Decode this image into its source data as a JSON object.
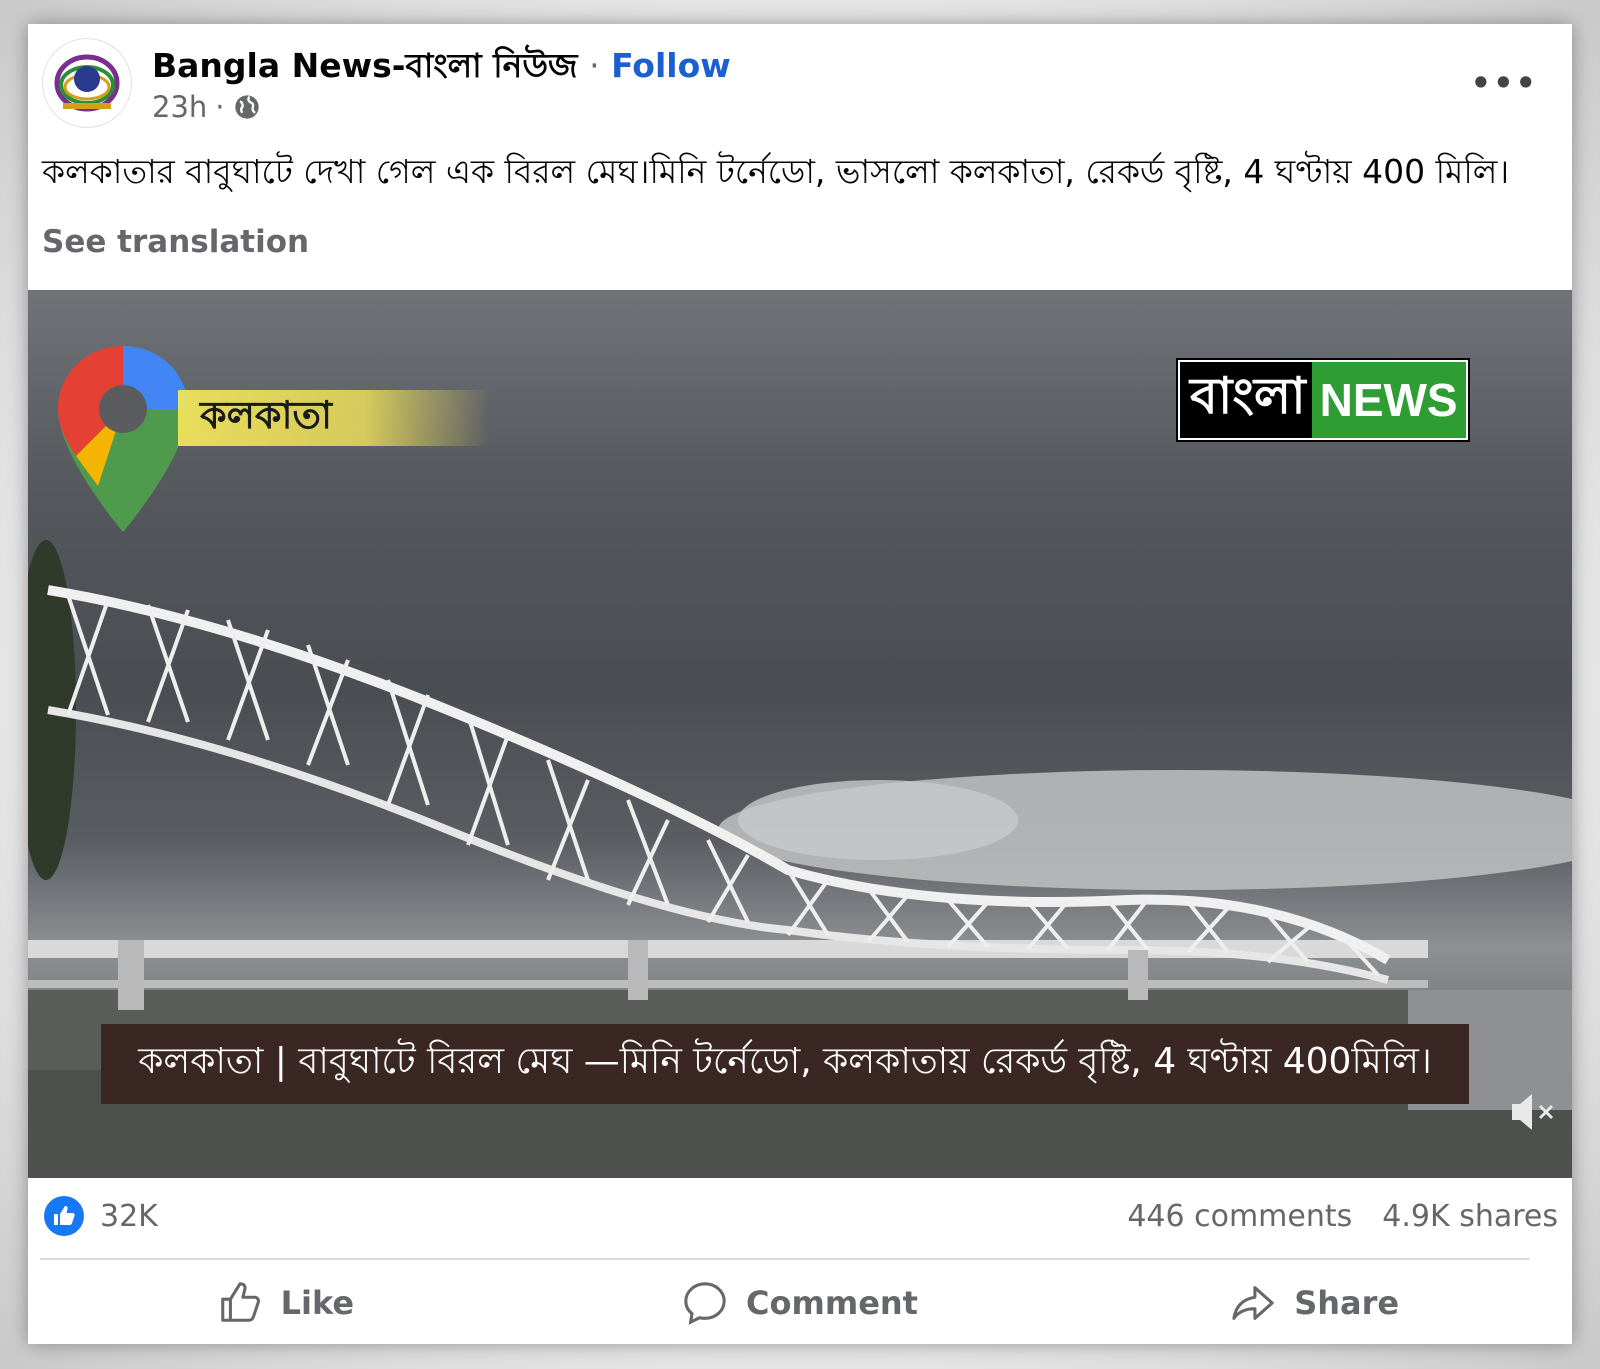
{
  "post": {
    "page_name": "Bangla News-বাংলা নিউজ",
    "separator": "·",
    "follow_label": "Follow",
    "time": "23h",
    "time_separator": "·",
    "more_label": "•••",
    "caption": "কলকাতার বাবুঘাটে দেখা গেল এক বিরল মেঘ।মিনি টর্নেডো, ভাসলো কলকাতা, রেকর্ড বৃষ্টি, 4 ঘণ্টায় 400 মিলি।",
    "see_translation": "See translation"
  },
  "video": {
    "location_tag": "কলকাতা",
    "brand_bangla": "বাংলা",
    "brand_news": "NEWS",
    "lower_third": "কলকাতা | বাবুঘাটে বিরল মেঘ —মিনি টর্নেডো, কলকাতায় রেকর্ড বৃষ্টি, 4 ঘণ্টায় 400মিলি।",
    "muted": true
  },
  "engagement": {
    "reaction_count": "32K",
    "comments": "446 comments",
    "shares": "4.9K shares"
  },
  "actions": {
    "like_label": "Like",
    "comment_label": "Comment",
    "share_label": "Share"
  },
  "icons": {
    "audience": "globe-icon",
    "reaction": "thumbs-up-icon",
    "video_sound": "muted-speaker-icon"
  },
  "colors": {
    "follow": "#1b5fd1",
    "like_badge": "#1877f2",
    "brand_green": "#2e9d34",
    "lower_third_bg": "#3a2723"
  }
}
